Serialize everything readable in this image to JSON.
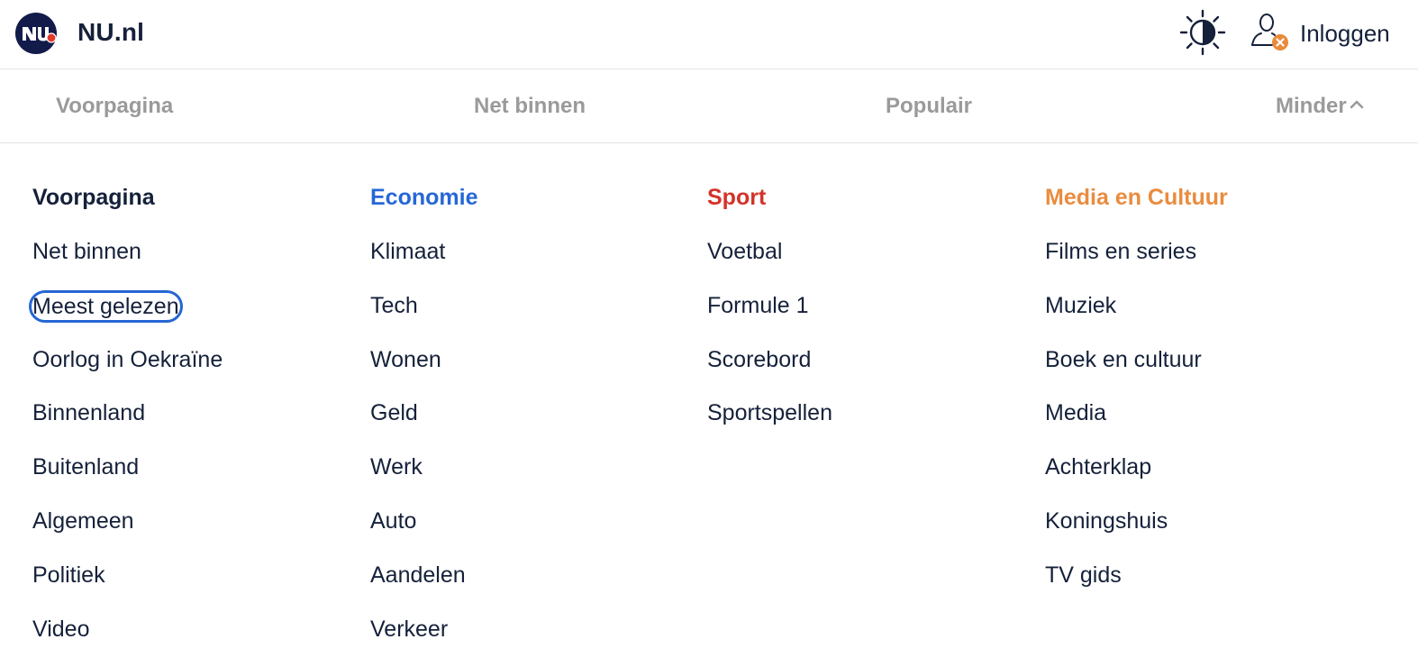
{
  "header": {
    "brand": "NU.nl",
    "login_label": "Inloggen",
    "icons": [
      "nu-logo-icon",
      "theme-toggle-icon",
      "user-icon"
    ],
    "colors": {
      "logo_bg": "#121b4a",
      "logo_badge": "#e2392b",
      "user_badge": "#e98a3a"
    }
  },
  "nav": {
    "items": [
      {
        "label": "Voorpagina"
      },
      {
        "label": "Net binnen"
      },
      {
        "label": "Populair"
      },
      {
        "label": "Minder"
      }
    ]
  },
  "menu": {
    "columns": [
      {
        "heading": "Voorpagina",
        "color": "#15213a",
        "items": [
          "Net binnen",
          "Meest gelezen",
          "Oorlog in Oekraïne",
          "Binnenland",
          "Buitenland",
          "Algemeen",
          "Politiek",
          "Video"
        ]
      },
      {
        "heading": "Economie",
        "color": "#2667d6",
        "items": [
          "Klimaat",
          "Tech",
          "Wonen",
          "Geld",
          "Werk",
          "Auto",
          "Aandelen",
          "Verkeer"
        ]
      },
      {
        "heading": "Sport",
        "color": "#d3332a",
        "items": [
          "Voetbal",
          "Formule 1",
          "Scorebord",
          "Sportspellen"
        ]
      },
      {
        "heading": "Media en Cultuur",
        "color": "#e98c3f",
        "items": [
          "Films en series",
          "Muziek",
          "Boek en cultuur",
          "Media",
          "Achterklap",
          "Koningshuis",
          "TV gids"
        ]
      }
    ],
    "focused_item": "Meest gelezen"
  }
}
